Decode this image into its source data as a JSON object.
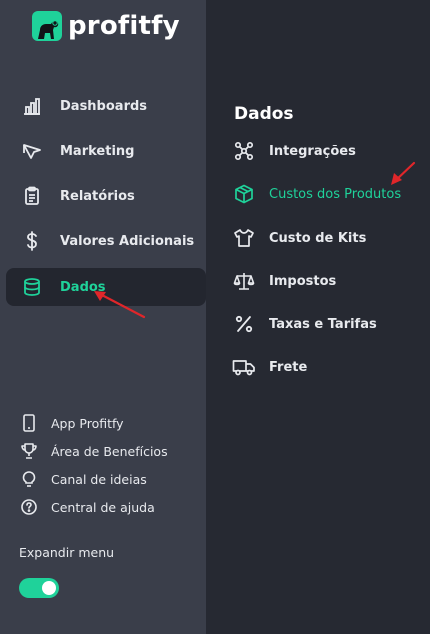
{
  "brand": {
    "name": "profitfy",
    "accent": "#1fd29a"
  },
  "sidebar": {
    "items": [
      {
        "label": "Dashboards",
        "icon": "bar-chart-icon"
      },
      {
        "label": "Marketing",
        "icon": "megaphone-icon"
      },
      {
        "label": "Relatórios",
        "icon": "clipboard-icon"
      },
      {
        "label": "Valores Adicionais",
        "icon": "dollar-icon"
      },
      {
        "label": "Dados",
        "icon": "database-icon",
        "active": true
      }
    ],
    "footer": [
      {
        "label": "App Profitfy",
        "icon": "smartphone-icon"
      },
      {
        "label": "Área de Benefícios",
        "icon": "trophy-icon"
      },
      {
        "label": "Canal de ideias",
        "icon": "lightbulb-icon"
      },
      {
        "label": "Central de ajuda",
        "icon": "help-circle-icon"
      }
    ],
    "expand_label": "Expandir menu",
    "expand_toggle_on": true
  },
  "submenu": {
    "title": "Dados",
    "items": [
      {
        "label": "Integrações",
        "icon": "share-nodes-icon"
      },
      {
        "label": "Custos dos Produtos",
        "icon": "box-icon",
        "active": true
      },
      {
        "label": "Custo de Kits",
        "icon": "shirt-icon"
      },
      {
        "label": "Impostos",
        "icon": "scale-icon"
      },
      {
        "label": "Taxas e Tarifas",
        "icon": "percent-icon"
      },
      {
        "label": "Frete",
        "icon": "truck-icon"
      }
    ]
  },
  "annotation_color": "#e0262a"
}
